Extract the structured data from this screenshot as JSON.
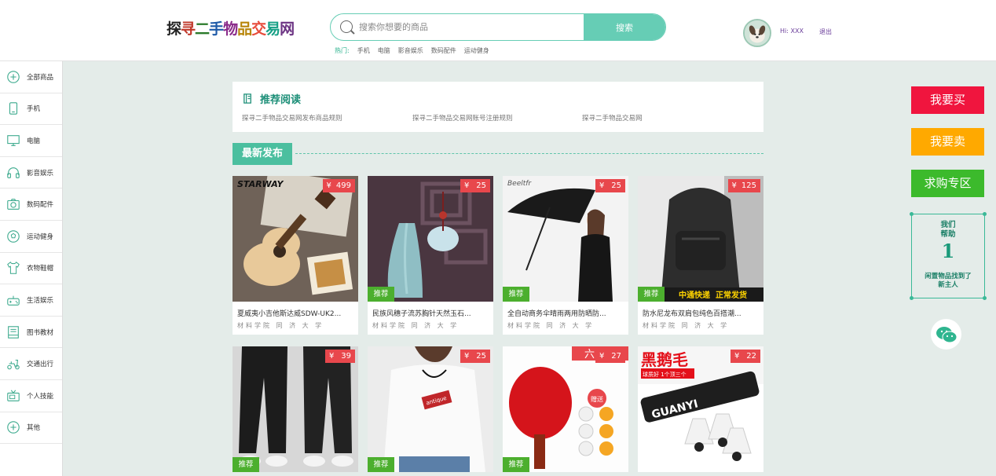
{
  "header": {
    "logo": "探寻二手物品交易网",
    "search": {
      "placeholder": "搜索你想要的商品",
      "button": "搜索"
    },
    "hot": {
      "label": "热门:",
      "items": [
        "手机",
        "电脑",
        "影音娱乐",
        "数码配件",
        "运动健身"
      ]
    },
    "user": {
      "greeting": "Hi: XXX",
      "logout": "退出"
    }
  },
  "sidebar": {
    "items": [
      {
        "label": "全部商品",
        "icon": "plus-circle-icon"
      },
      {
        "label": "手机",
        "icon": "phone-icon"
      },
      {
        "label": "电脑",
        "icon": "monitor-icon"
      },
      {
        "label": "影音娱乐",
        "icon": "headphones-icon"
      },
      {
        "label": "数码配件",
        "icon": "camera-icon"
      },
      {
        "label": "运动健身",
        "icon": "ball-icon"
      },
      {
        "label": "衣物鞋帽",
        "icon": "shirt-icon"
      },
      {
        "label": "生活娱乐",
        "icon": "gamepad-icon"
      },
      {
        "label": "图书教材",
        "icon": "book-icon"
      },
      {
        "label": "交通出行",
        "icon": "scooter-icon"
      },
      {
        "label": "个人技能",
        "icon": "tv-icon"
      },
      {
        "label": "其他",
        "icon": "plus-circle-icon"
      }
    ]
  },
  "recommend": {
    "title": "推荐阅读",
    "links": [
      "探寻二手物品交易网发布商品规则",
      "探寻二手物品交易网账号注册规则",
      "探寻二手物品交易网"
    ]
  },
  "latest": {
    "title": "最新发布"
  },
  "products": [
    {
      "title": "夏威夷小吉他斯达威SDW-UK2...",
      "price": "499",
      "currency": "¥",
      "tag": "",
      "school": "材料学院 同 济 大 学",
      "image": "ukulele"
    },
    {
      "title": "民族风穗子流苏胸针天然玉石...",
      "price": "25",
      "currency": "¥",
      "tag": "推荐",
      "school": "材料学院 同 济 大 学",
      "image": "tassel"
    },
    {
      "title": "全自动商务伞晴雨两用防晒防...",
      "price": "25",
      "currency": "¥",
      "tag": "推荐",
      "school": "材料学院 同 济 大 学",
      "image": "umbrella"
    },
    {
      "title": "防水尼龙布双肩包纯色百搭潮...",
      "price": "125",
      "currency": "¥",
      "tag": "推荐",
      "school": "材料学院 同 济 大 学",
      "image": "backpack",
      "banner": "中通快递  正常发货"
    },
    {
      "title": "",
      "price": "39",
      "currency": "¥",
      "tag": "推荐",
      "school": "",
      "image": "pants"
    },
    {
      "title": "",
      "price": "25",
      "currency": "¥",
      "tag": "推荐",
      "school": "",
      "image": "tshirt",
      "shirt_text": "antique"
    },
    {
      "title": "",
      "price": "27",
      "currency": "¥",
      "tag": "推荐",
      "school": "",
      "image": "pingpong",
      "corner_text": "六",
      "ball_text": "赠送"
    },
    {
      "title": "",
      "price": "22",
      "currency": "¥",
      "tag": "",
      "school": "",
      "image": "shuttlecock",
      "brand": "黑鹅毛",
      "sub": "球质好 1个顶三个",
      "can": "GUANYI"
    }
  ],
  "right": {
    "buy": "我要买",
    "sell": "我要卖",
    "wanted": "求购专区",
    "help": {
      "line1": "我们",
      "line2": "帮助",
      "count": "1",
      "line3": "闲置物品找到了",
      "line4": "新主人"
    }
  },
  "colors": {
    "accent": "#66cdb5",
    "price": "#e8474c",
    "tag": "#4caf2e",
    "buy": "#f0153e",
    "sell": "#ffa900",
    "wanted": "#3cba2c"
  }
}
